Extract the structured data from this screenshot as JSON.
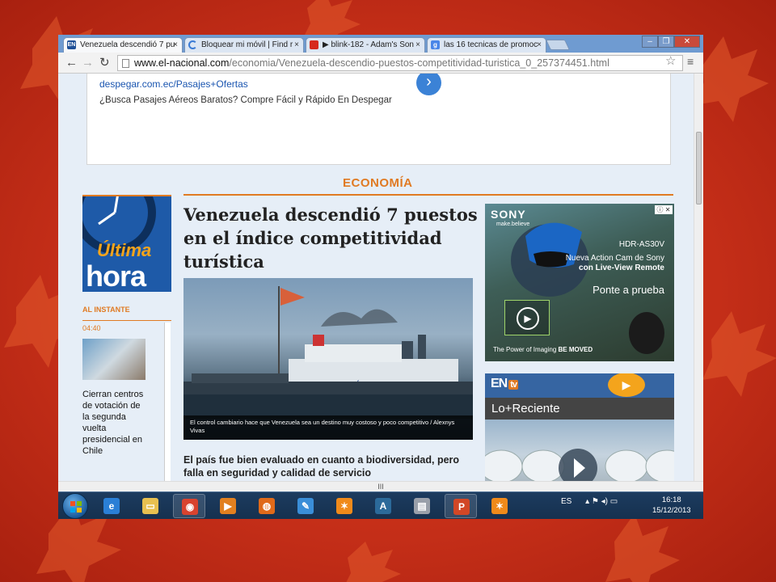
{
  "browser": {
    "tabs": [
      {
        "title": "Venezuela descendió 7 pu",
        "favicon": "el-nacional-favicon",
        "active": true
      },
      {
        "title": "Bloquear mi móvil | Find r",
        "favicon": "loading-icon",
        "active": false
      },
      {
        "title": "▶ blink-182 - Adam's Son",
        "favicon": "youtube-icon",
        "active": false
      },
      {
        "title": "las 16 tecnicas de promoc",
        "favicon": "google-icon",
        "active": false
      }
    ],
    "tab_close": "×",
    "window_controls": {
      "minimize": "–",
      "restore": "❐",
      "close": "✕"
    },
    "url_host": "www.el-nacional.com",
    "url_path": "/economia/Venezuela-descendio-puestos-competitividad-turistica_0_257374451.html",
    "nav": {
      "back": "←",
      "forward": "→",
      "reload": "↻"
    },
    "star": "☆",
    "menu": "≡",
    "hscroll_grip": "III"
  },
  "ad_top": {
    "link": "despegar.com.ec/Pasajes+Ofertas",
    "text": "¿Busca Pasajes Aéreos Baratos? Compre Fácil y Rápido En Despegar",
    "arrow": "›"
  },
  "section_title": "ECONOMÍA",
  "sidebar": {
    "ultima": "Última",
    "hora": "hora",
    "al_instante": "AL INSTANTE",
    "time": "04:40",
    "news_text": "Cierran centros de votación de la segunda vuelta presidencial en Chile"
  },
  "article": {
    "headline": "Venezuela descendió 7 puestos en el índice competitividad turística",
    "caption": "El control cambiario hace que Venezuela sea un destino muy costoso y poco competitivo / Alexnys Vivas",
    "subhead": "El país fue bien evaluado en cuanto a biodiversidad, pero falla en seguridad y calidad de servicio"
  },
  "sony_ad": {
    "brand": "SONY",
    "tagline": "make.believe",
    "model": "HDR-AS30V",
    "text_line1": "Nueva Action Cam de Sony",
    "text_line2": "con Live-View Remote",
    "cta": "Ponte a prueba",
    "footer_prefix": "The Power of Imaging",
    "footer_bold": "BE MOVED",
    "close": "ⓘ ✕",
    "play": "▶"
  },
  "entv": {
    "logo": "EN",
    "logo_tv": "tv",
    "bar": "Lo+Reciente",
    "play": "▶"
  },
  "taskbar": {
    "apps": [
      {
        "name": "internet-explorer-icon",
        "glyph": "e",
        "color": "#2a7fd6",
        "open": false
      },
      {
        "name": "file-explorer-icon",
        "glyph": "▭",
        "color": "#e8c050",
        "open": false
      },
      {
        "name": "chrome-icon",
        "glyph": "◉",
        "color": "#d9432f",
        "open": true
      },
      {
        "name": "media-player-icon",
        "glyph": "▶",
        "color": "#e2801f",
        "open": false
      },
      {
        "name": "firefox-icon",
        "glyph": "◍",
        "color": "#e06a1a",
        "open": false
      },
      {
        "name": "paint-icon",
        "glyph": "✎",
        "color": "#3a8ed8",
        "open": false
      },
      {
        "name": "avast-icon",
        "glyph": "✶",
        "color": "#f08a1a",
        "open": false
      },
      {
        "name": "archicad-icon",
        "glyph": "A",
        "color": "#2c6a9a",
        "open": false
      },
      {
        "name": "folder-icon",
        "glyph": "▤",
        "color": "#9aa0aa",
        "open": false
      },
      {
        "name": "powerpoint-icon",
        "glyph": "P",
        "color": "#d24726",
        "open": true
      },
      {
        "name": "avast-tray-icon",
        "glyph": "✶",
        "color": "#f08a1a",
        "open": false
      }
    ],
    "language": "ES",
    "tray_icons": "▴  ⚑  ◂)  ▭",
    "time": "16:18",
    "date": "15/12/2013"
  }
}
